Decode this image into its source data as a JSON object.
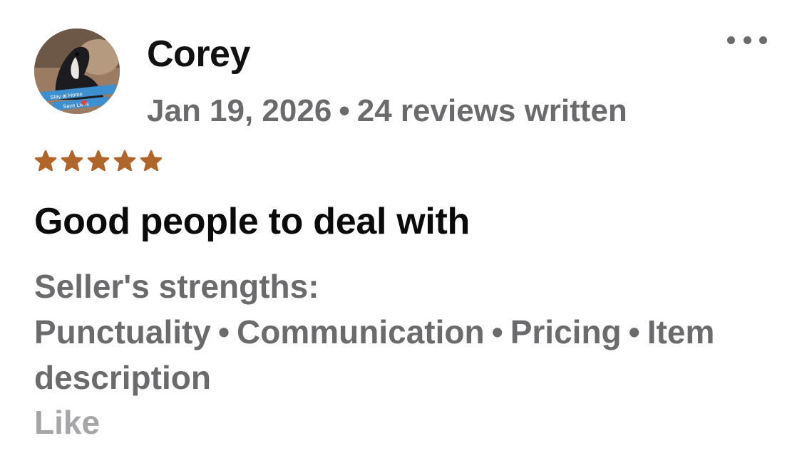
{
  "reviewer": {
    "name": "Corey",
    "avatar_text_line1": "Stay at Home",
    "avatar_text_line2": "Save Lives"
  },
  "meta": {
    "date": "Jan 19, 2026",
    "separator": "•",
    "reviews_written": "24 reviews written"
  },
  "rating": {
    "stars": 5,
    "max": 5,
    "color": "#b0652a"
  },
  "review": {
    "title": "Good people to deal with",
    "strengths_label": "Seller's strengths:",
    "strengths": [
      "Punctuality",
      "Communication",
      "Pricing",
      "Item description"
    ]
  },
  "actions": {
    "more_icon": "more-horizontal-icon",
    "like_label": "Like"
  }
}
